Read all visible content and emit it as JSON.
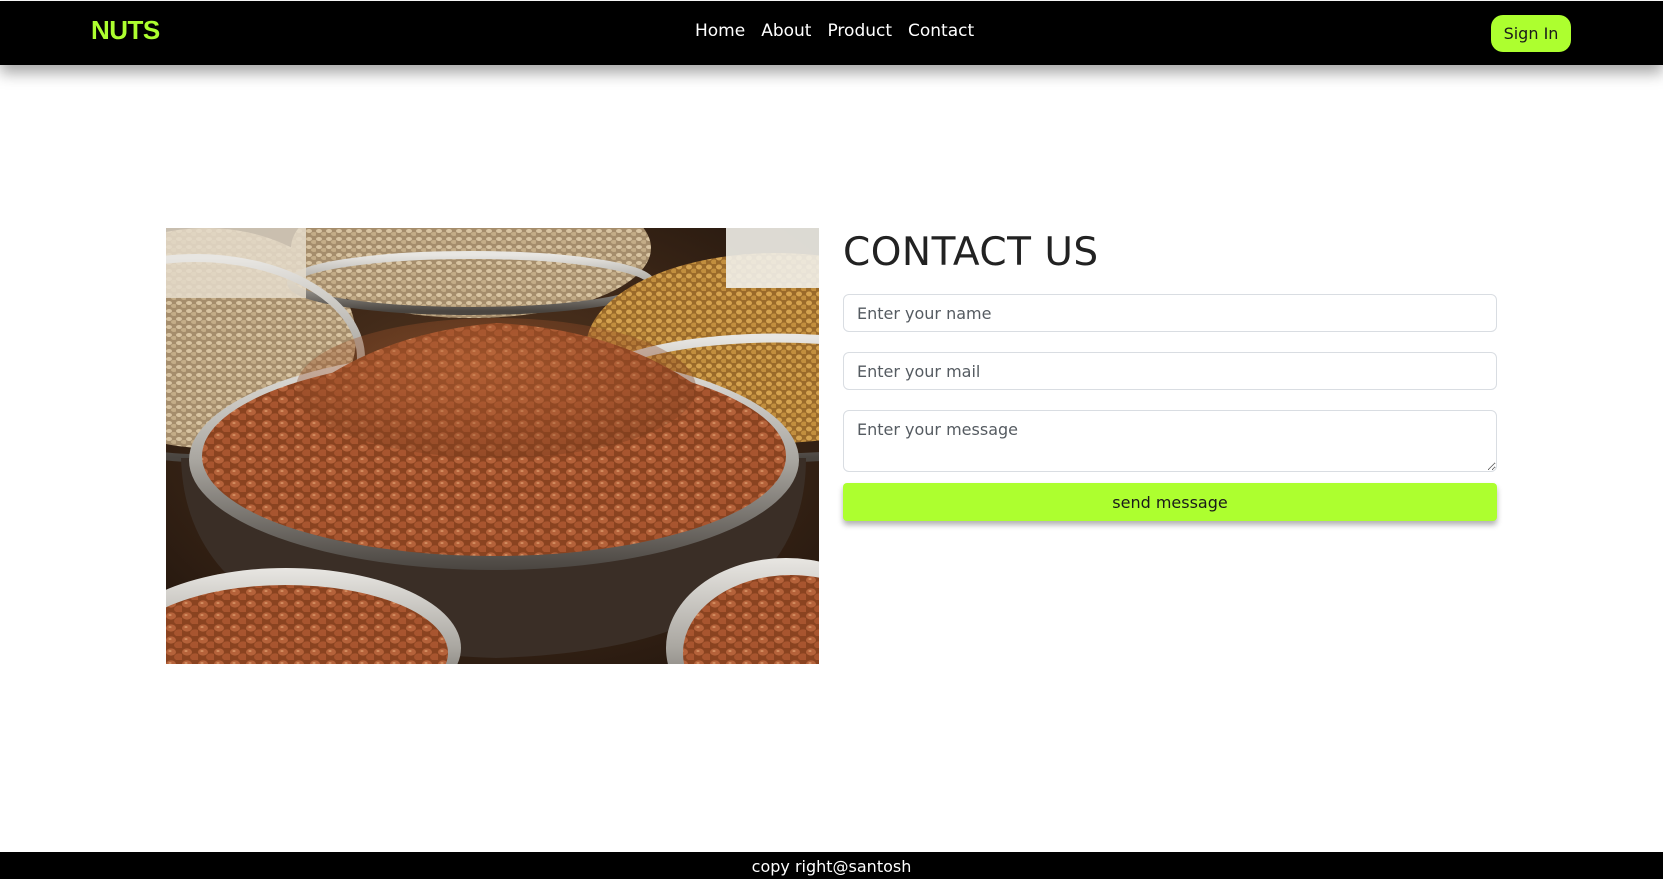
{
  "navbar": {
    "brand": "NUTS",
    "links": [
      "Home",
      "About",
      "Product",
      "Contact"
    ],
    "signin_label": "Sign In"
  },
  "contact": {
    "title": "CONTACT US",
    "name_placeholder": "Enter your name",
    "mail_placeholder": "Enter your mail",
    "message_placeholder": "Enter your message",
    "send_label": "send message",
    "image_icon": "bowls-of-peanuts-photo"
  },
  "footer": {
    "text": "copy right@santosh"
  },
  "colors": {
    "accent": "#adff2f",
    "navbar_bg": "#000000",
    "footer_bg": "#000000"
  }
}
